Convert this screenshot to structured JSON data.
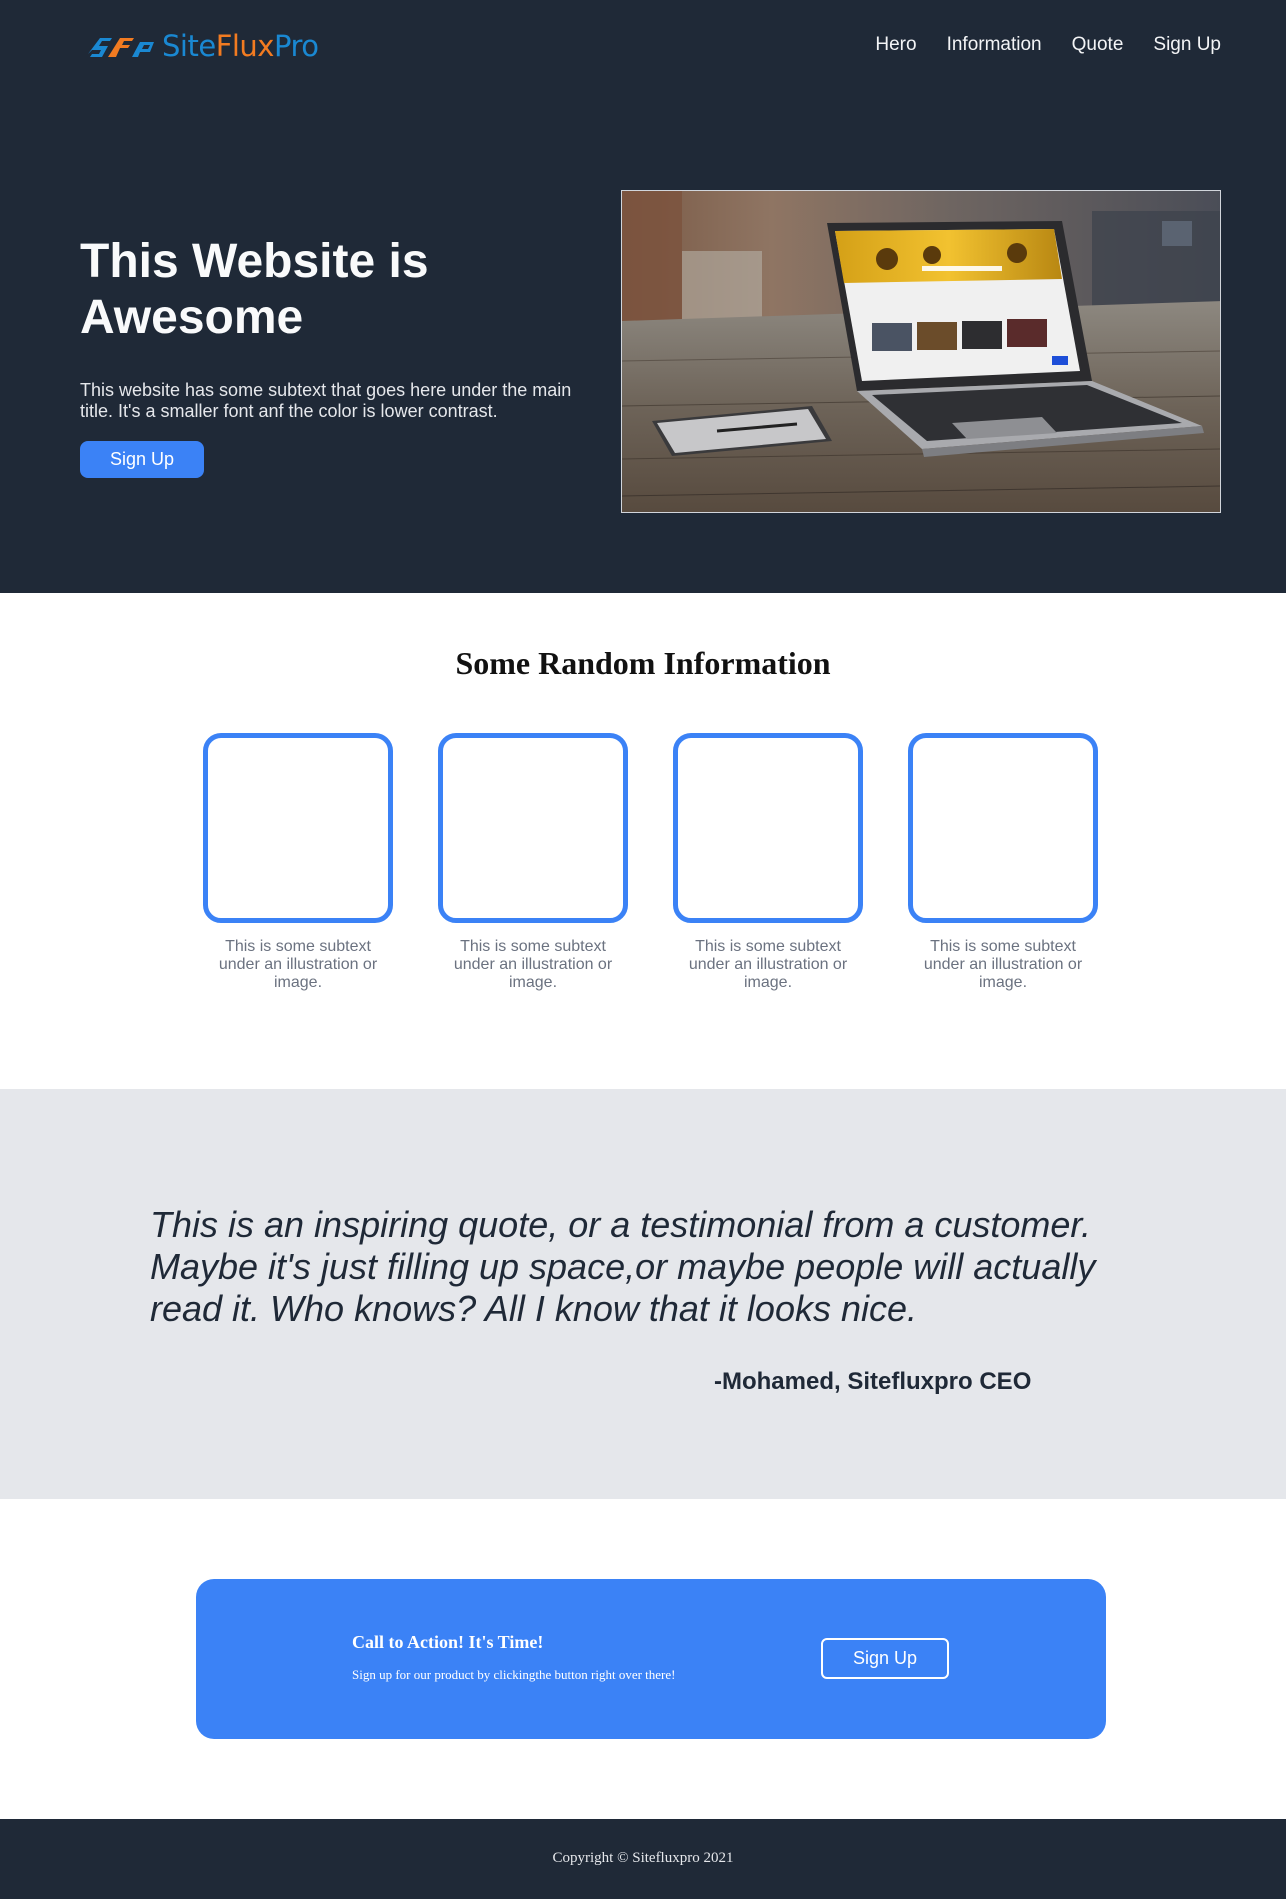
{
  "brand": {
    "logo_icon": "sfp-logo-icon",
    "name_part1": "Site",
    "name_part2": "Flux",
    "name_part3": "Pro"
  },
  "nav": {
    "items": [
      "Hero",
      "Information",
      "Quote",
      "Sign Up"
    ]
  },
  "hero": {
    "title": "This Website is Awesome",
    "subtext": "This website has some subtext that goes here under the main title. It's a smaller font anf the color is lower contrast.",
    "button_label": "Sign Up",
    "image": "laptop-on-wooden-desk-photo"
  },
  "info": {
    "title": "Some Random Information",
    "cards": [
      {
        "text": "This is some subtext under an illustration or image."
      },
      {
        "text": "This is some subtext under an illustration or image."
      },
      {
        "text": "This is some subtext under an illustration or image."
      },
      {
        "text": "This is some subtext under an illustration or image."
      }
    ]
  },
  "quote": {
    "text": "This is an inspiring quote, or a testimonial from a customer. Maybe it's just filling up space,or maybe people will actually read it. Who knows? All I know that it looks nice.",
    "author": "-Mohamed, Sitefluxpro CEO"
  },
  "cta": {
    "title": "Call to Action! It's Time!",
    "subtext": "Sign up for our product by clickingthe button right over there!",
    "button_label": "Sign Up"
  },
  "footer": {
    "copyright": "Copyright © Sitefluxpro 2021"
  },
  "colors": {
    "dark_bg": "#1f2937",
    "accent_blue": "#3b82f6",
    "quote_bg": "#e5e7eb",
    "logo_blue": "#1a88d2",
    "logo_orange": "#f27b21"
  }
}
